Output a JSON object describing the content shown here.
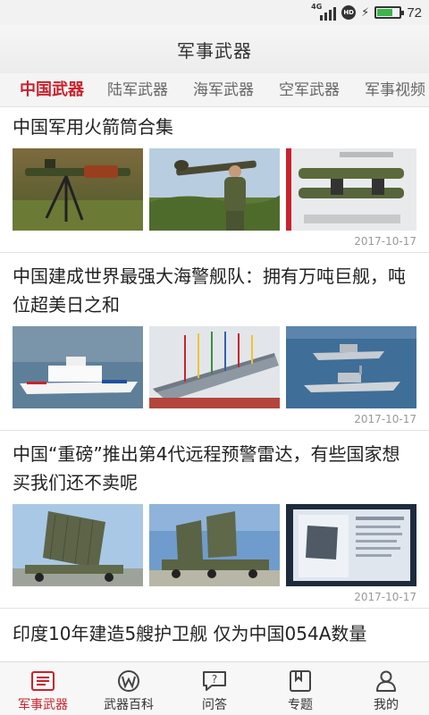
{
  "status_bar": {
    "network": "4G",
    "hd_badge": "HD",
    "battery_percent": 72,
    "battery_label": "72"
  },
  "header": {
    "title": "军事武器"
  },
  "category_tabs": [
    {
      "label": "中国武器",
      "active": true
    },
    {
      "label": "陆军武器",
      "active": false
    },
    {
      "label": "海军武器",
      "active": false
    },
    {
      "label": "空军武器",
      "active": false
    },
    {
      "label": "军事视频",
      "active": false
    }
  ],
  "articles": [
    {
      "title": "中国军用火箭筒合集",
      "date": "2017-10-17",
      "images": [
        "rocket-launcher-on-tripod-photo",
        "soldier-with-rpg-photo",
        "twin-launch-tubes-photo"
      ]
    },
    {
      "title": "中国建成世界最强大海警舰队：拥有万吨巨舰，吨位超美日之和",
      "date": "2017-10-17",
      "images": [
        "coast-guard-ship-photo",
        "ship-launch-ceremony-photo",
        "warships-at-sea-photo"
      ]
    },
    {
      "title": "中国“重磅”推出第4代远程预警雷达，有些国家想买我们还不卖呢",
      "date": "2017-10-17",
      "images": [
        "radar-array-truck-photo",
        "radar-vehicles-photo",
        "radar-display-screen-photo"
      ]
    },
    {
      "title": "印度10年建造5艘护卫舰 仅为中国054A数量",
      "date": "",
      "images": []
    }
  ],
  "bottom_nav": [
    {
      "label": "军事武器",
      "icon": "newspaper-icon",
      "active": true
    },
    {
      "label": "武器百科",
      "icon": "encyclopedia-w-icon",
      "active": false
    },
    {
      "label": "问答",
      "icon": "question-bubble-icon",
      "active": false
    },
    {
      "label": "专题",
      "icon": "topic-bookmark-icon",
      "active": false
    },
    {
      "label": "我的",
      "icon": "profile-person-icon",
      "active": false
    }
  ],
  "colors": {
    "accent": "#c8232c",
    "battery": "#3cb44a"
  }
}
